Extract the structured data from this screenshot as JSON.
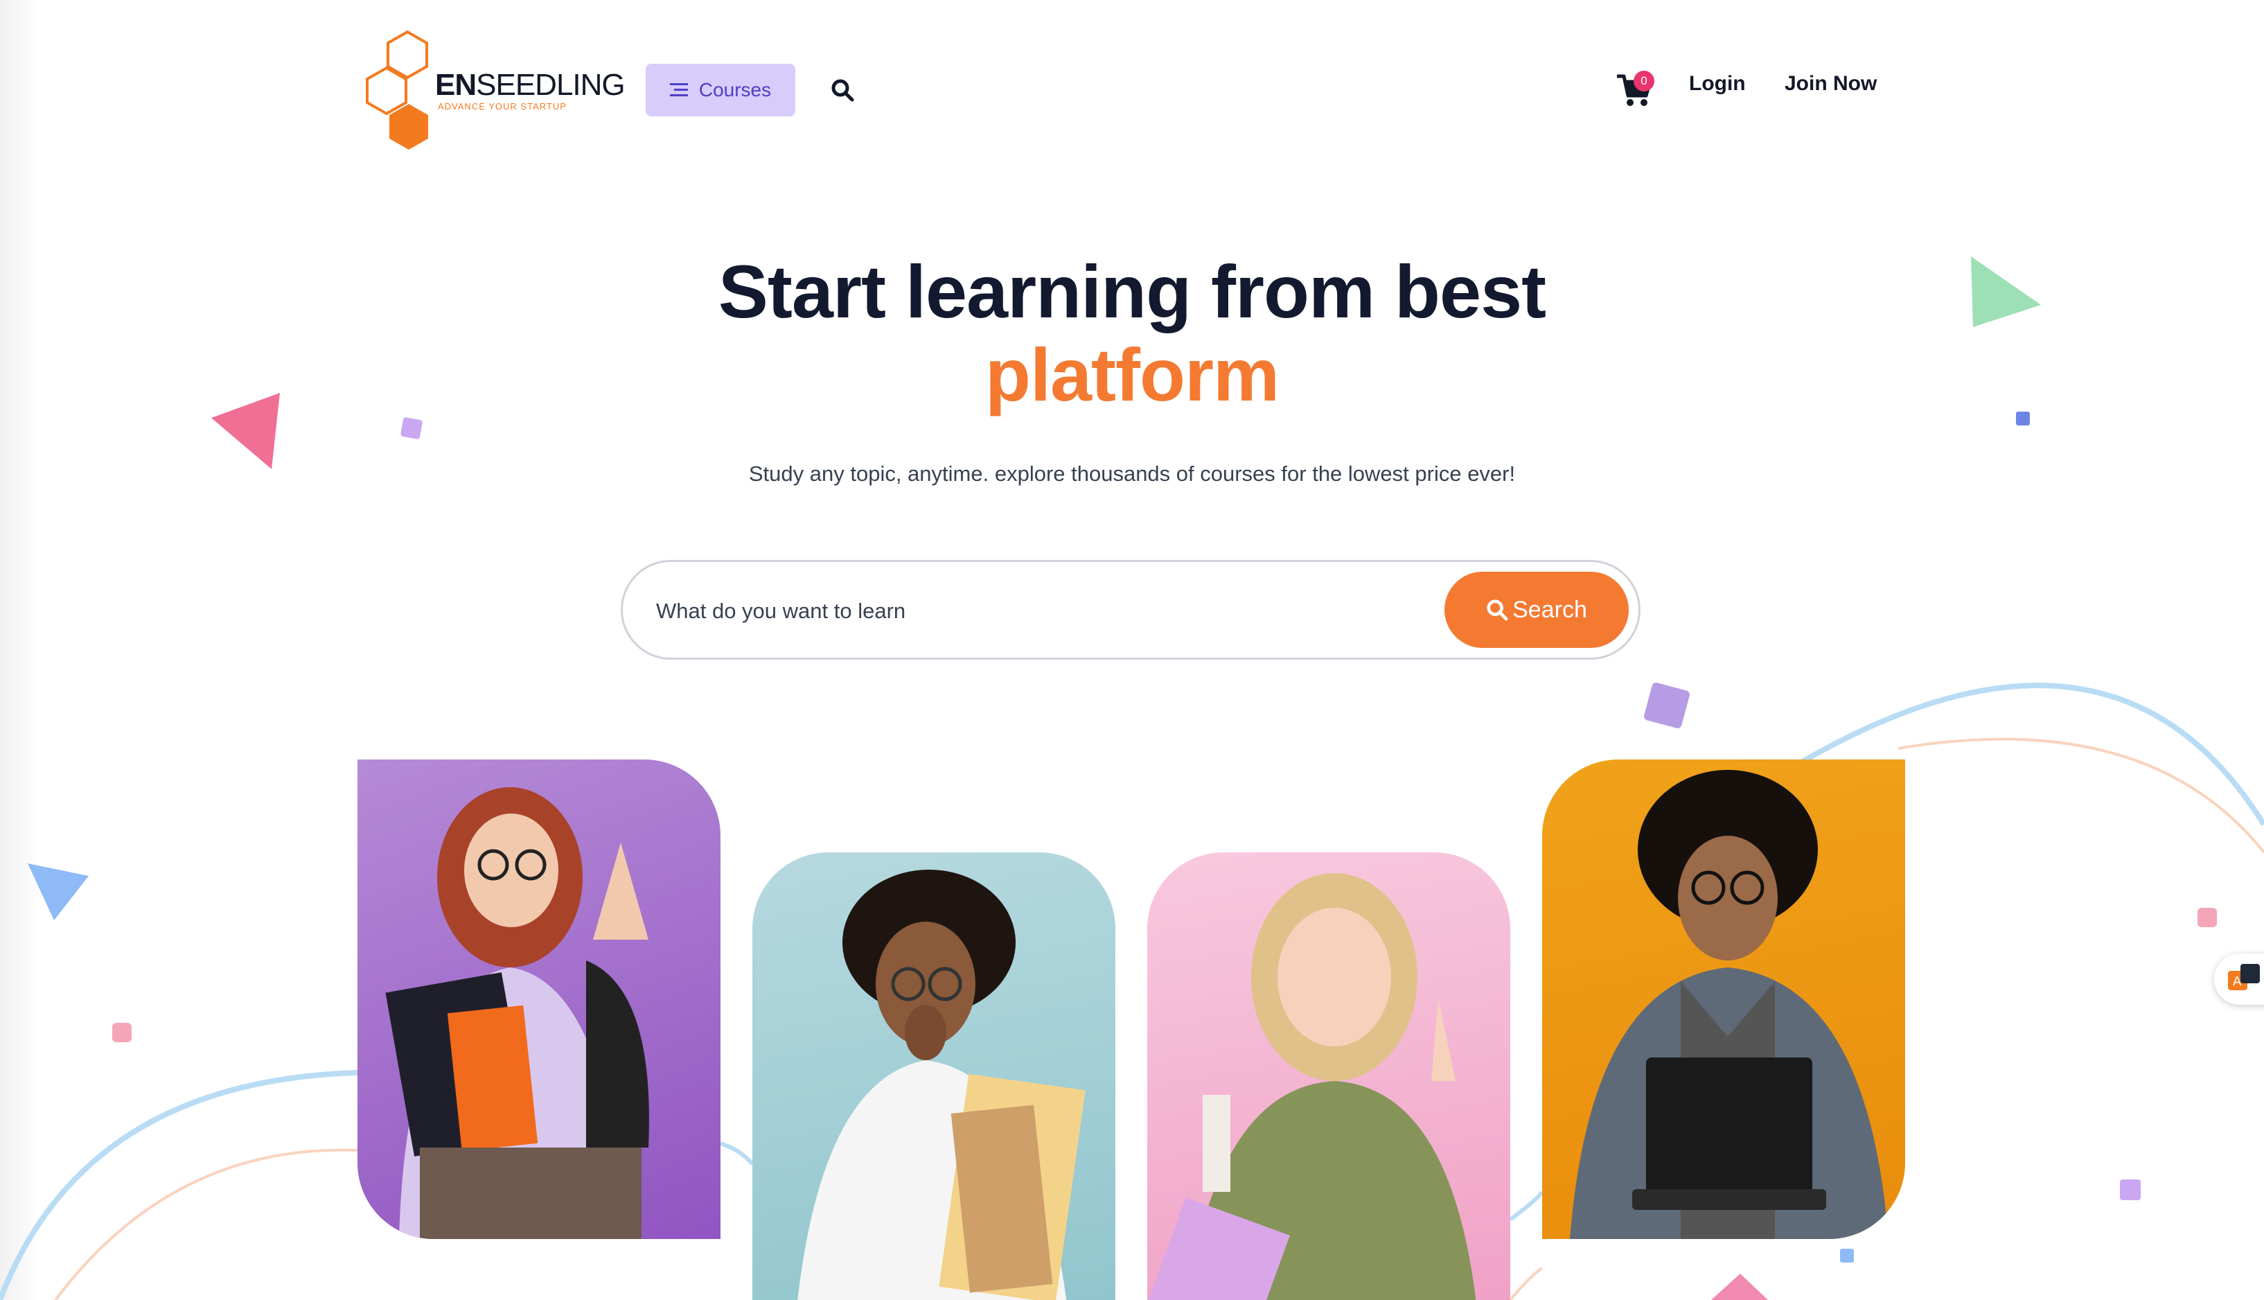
{
  "brand": {
    "name_prefix": "EN",
    "name_rest": "SEEDLING",
    "tagline": "ADVANCE YOUR STARTUP"
  },
  "nav": {
    "courses_label": "Courses",
    "cart_count": "0",
    "login_label": "Login",
    "join_label": "Join Now"
  },
  "hero": {
    "title_line1": "Start learning from best",
    "title_line2": "platform",
    "subtitle": "Study any topic, anytime. explore thousands of courses for the lowest price ever!"
  },
  "search": {
    "placeholder": "What do you want to learn",
    "button_label": "Search"
  },
  "colors": {
    "accent_orange": "#f47a32",
    "courses_bg": "#d8ccfb",
    "badge_pink": "#e8356d",
    "title_navy": "#131a2f"
  },
  "icons": [
    "menu-lines-icon",
    "search-icon",
    "cart-icon"
  ]
}
